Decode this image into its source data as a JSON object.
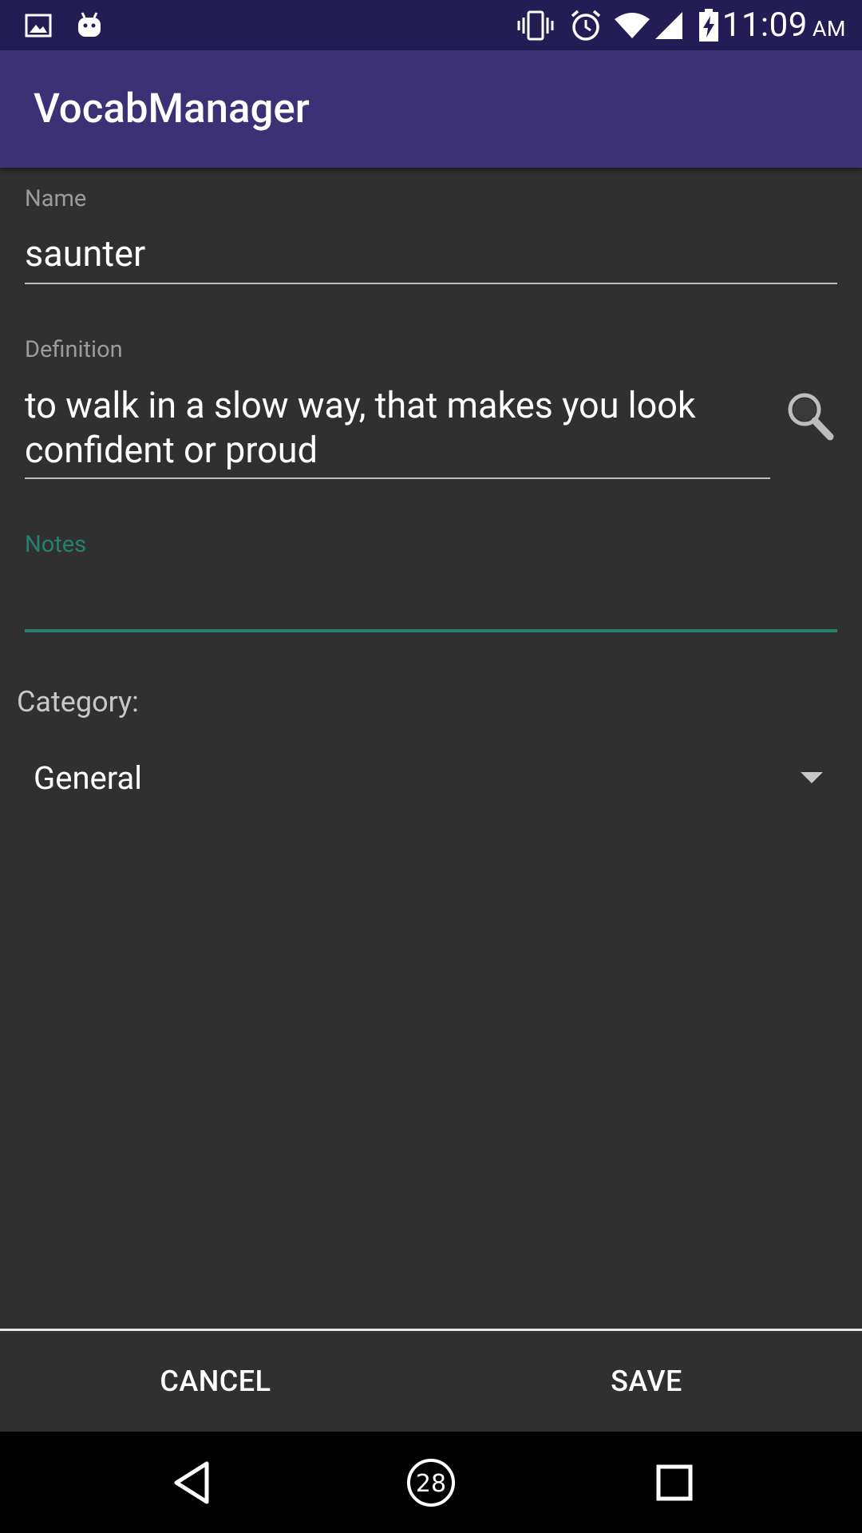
{
  "status_bar": {
    "time": "11:09",
    "ampm": "AM",
    "icons": [
      "image-icon",
      "android-icon",
      "vibrate-icon",
      "alarm-icon",
      "wifi-icon",
      "signal-icon",
      "battery-charging-icon"
    ]
  },
  "app_bar": {
    "title": "VocabManager"
  },
  "form": {
    "name": {
      "label": "Name",
      "value": "saunter"
    },
    "definition": {
      "label": "Definition",
      "line1": "to walk in a slow way, that makes you look",
      "line2": "confident or proud"
    },
    "notes": {
      "label": "Notes",
      "value": ""
    },
    "category": {
      "label": "Category:",
      "selected": "General"
    }
  },
  "actions": {
    "cancel": "CANCEL",
    "save": "SAVE"
  },
  "nav_bar": {
    "recents_badge": "28"
  },
  "colors": {
    "status_bar": "#231c55",
    "app_bar": "#3d3175",
    "background": "#303030",
    "accent": "#26806e"
  }
}
